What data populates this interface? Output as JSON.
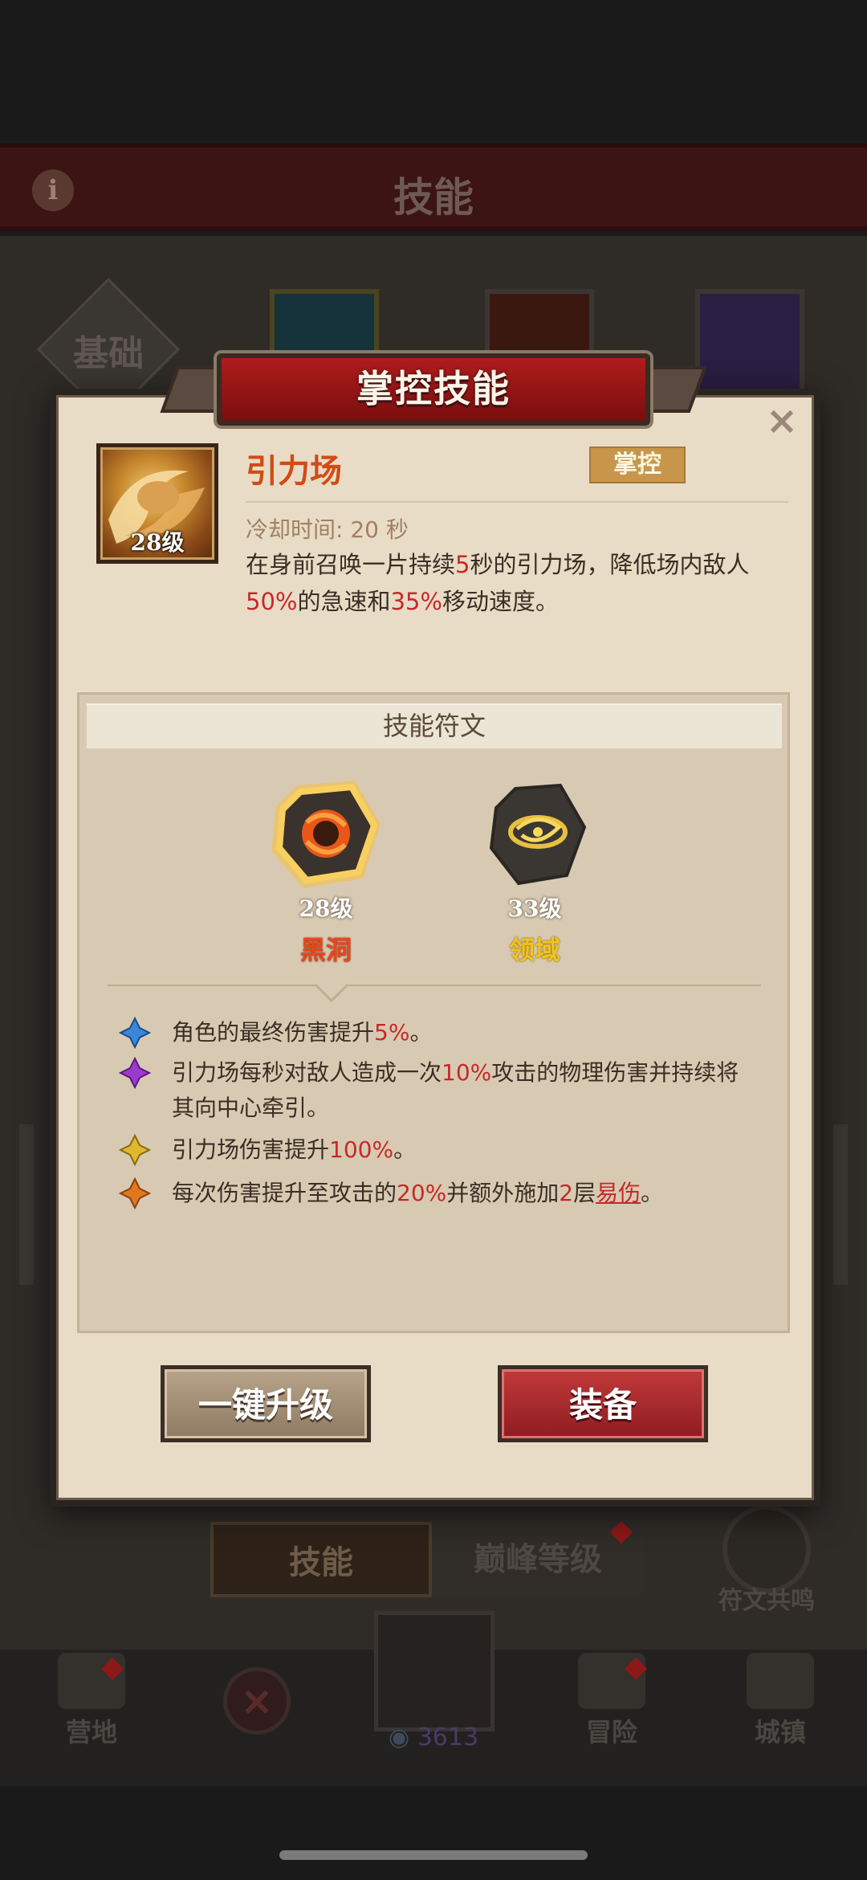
{
  "background": {
    "screen_title": "技能",
    "info_icon": "i",
    "category_label": "基础",
    "tabs": [
      {
        "label": "技能"
      },
      {
        "label": "巅峰等级"
      }
    ],
    "resonance_label": "符文共鸣",
    "nav": [
      {
        "label": "营地",
        "icon": "tent-icon"
      },
      {
        "label": "冒险",
        "icon": "map-icon"
      },
      {
        "label": "城镇",
        "icon": "castle-icon"
      }
    ],
    "currency_count": "3613"
  },
  "modal": {
    "title": "掌控技能",
    "close": "×",
    "skill": {
      "name": "引力场",
      "level": "28级",
      "tag": "掌控",
      "cooldown": "冷却时间: 20 秒",
      "desc": {
        "p1": "在身前召唤一片持续",
        "v1": "5",
        "p2": "秒的引力场，降低场内敌人",
        "v2": "50%",
        "p3": "的急速和",
        "v3": "35%",
        "p4": "移动速度。"
      }
    },
    "runes": {
      "header": "技能符文",
      "items": [
        {
          "level": "28级",
          "name": "黑洞",
          "color": "#e8461a"
        },
        {
          "level": "33级",
          "name": "领域",
          "color": "#f2c41a"
        }
      ],
      "effects": [
        {
          "star_color": "#3a86d8",
          "pre": "角色的最终伤害提升",
          "val": "5%",
          "post": "。"
        },
        {
          "star_color": "#9a3ad0",
          "pre": "引力场每秒对敌人造成一次",
          "val": "10%",
          "post": "攻击的物理伤害并持续将其向中心牵引。"
        },
        {
          "star_color": "#e0b830",
          "pre": "引力场伤害提升",
          "val": "100%",
          "post": "。"
        },
        {
          "star_color": "#e07820",
          "pre": "每次伤害提升至攻击的",
          "val": "20%",
          "mid": "并额外施加",
          "val2": "2",
          "mid2": "层",
          "link": "易伤",
          "post": "。"
        }
      ]
    },
    "buttons": {
      "upgrade": "一键升级",
      "equip": "装备"
    }
  }
}
